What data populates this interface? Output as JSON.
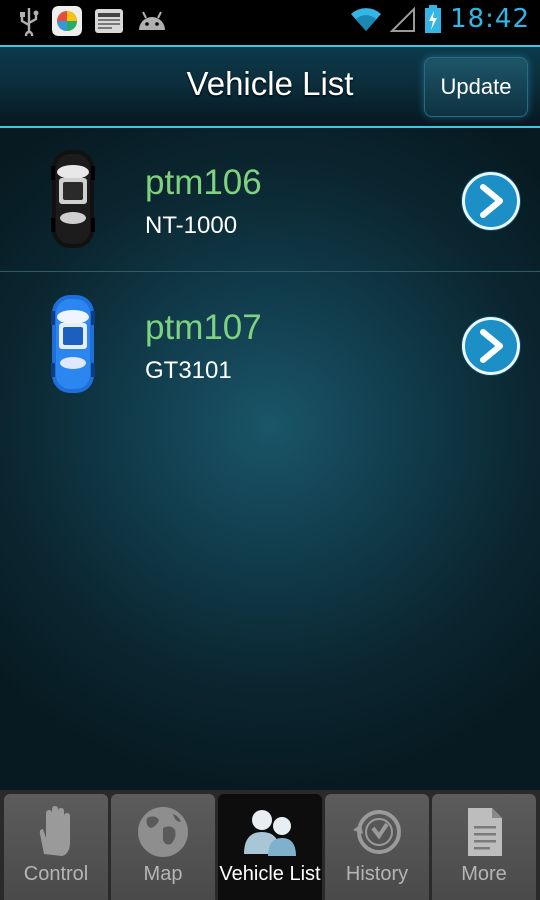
{
  "status_bar": {
    "time": "18:42",
    "icons": [
      "usb-icon",
      "photo-app-icon",
      "media-app-icon",
      "android-icon",
      "wifi-icon",
      "signal-icon",
      "battery-charging-icon"
    ]
  },
  "header": {
    "title": "Vehicle List",
    "update_label": "Update"
  },
  "vehicles": [
    {
      "name": "ptm106",
      "model": "NT-1000",
      "car_color": "#111111"
    },
    {
      "name": "ptm107",
      "model": "GT3101",
      "car_color": "#1e6fd9"
    }
  ],
  "tabs": [
    {
      "label": "Control",
      "icon": "hand-icon",
      "active": false
    },
    {
      "label": "Map",
      "icon": "globe-icon",
      "active": false
    },
    {
      "label": "Vehicle List",
      "icon": "users-icon",
      "active": true
    },
    {
      "label": "History",
      "icon": "history-icon",
      "active": false
    },
    {
      "label": "More",
      "icon": "document-icon",
      "active": false
    }
  ],
  "colors": {
    "accent": "#33b5e5",
    "vehicle_name": "#7fd27f",
    "go_button": "#1b8fc6"
  }
}
